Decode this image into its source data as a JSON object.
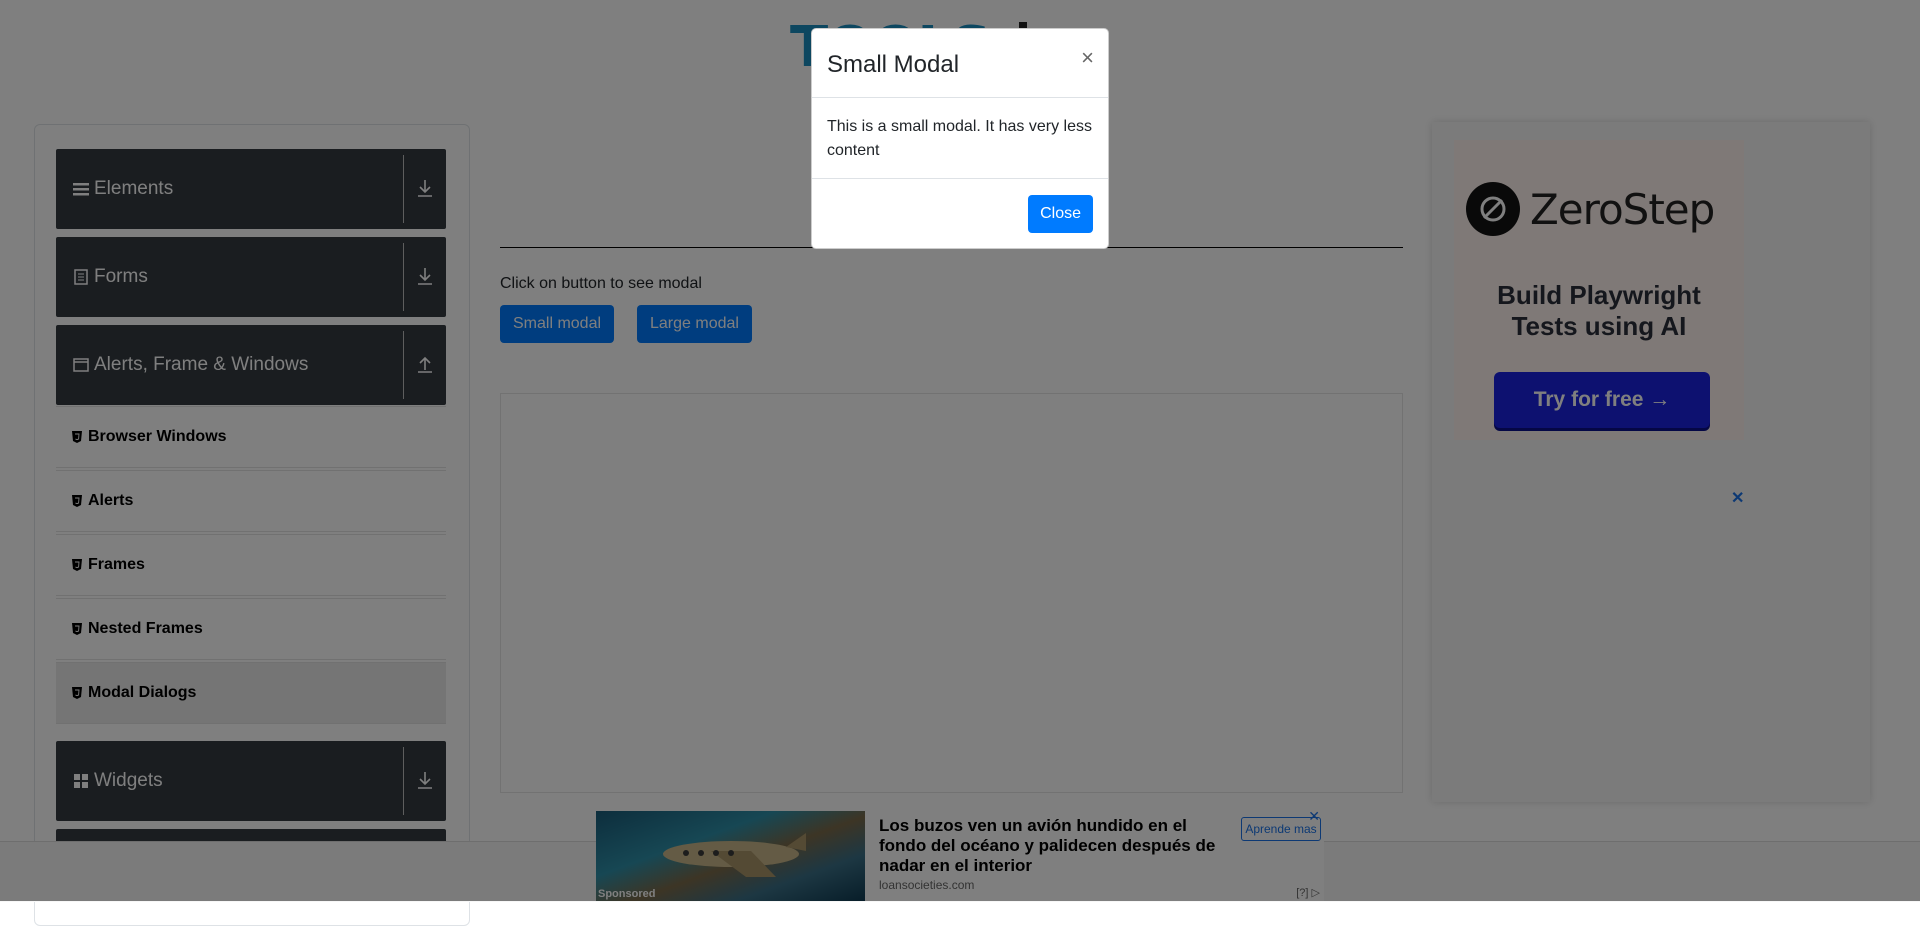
{
  "sidebar": {
    "groups": [
      {
        "label": "Elements",
        "icon": "hamburger-icon",
        "arrow": "download-icon"
      },
      {
        "label": "Forms",
        "icon": "document-icon",
        "arrow": "download-icon"
      },
      {
        "label": "Alerts, Frame & Windows",
        "icon": "window-icon",
        "arrow": "upload-icon"
      },
      {
        "label": "Widgets",
        "icon": "grid-icon",
        "arrow": "download-icon"
      }
    ],
    "items": [
      {
        "label": "Browser Windows"
      },
      {
        "label": "Alerts"
      },
      {
        "label": "Frames"
      },
      {
        "label": "Nested Frames"
      },
      {
        "label": "Modal Dialogs"
      }
    ],
    "group_color": "#343a40"
  },
  "main": {
    "hint": "Click on button to see modal",
    "small_modal_button": "Small modal",
    "large_modal_button": "Large modal"
  },
  "ad_right": {
    "brand": "ZeroStep",
    "tagline_line1": "Build Playwright",
    "tagline_line2": "Tests using AI",
    "cta": "Try for free →",
    "close": "✕"
  },
  "ad_bottom": {
    "sponsored": "Sponsored",
    "headline": "Los buzos ven un avión hundido en el fondo del océano y palidecen después de nadar en el interior",
    "domain": "loansocieties.com",
    "cta": "Aprende mas",
    "close": "✕",
    "info": "[?]"
  },
  "modal": {
    "title": "Small Modal",
    "close_x": "×",
    "body": "This is a small modal. It has very less content",
    "close_button": "Close"
  },
  "colors": {
    "primary": "#007bff",
    "overlay": "rgba(0,0,0,0.5)"
  }
}
